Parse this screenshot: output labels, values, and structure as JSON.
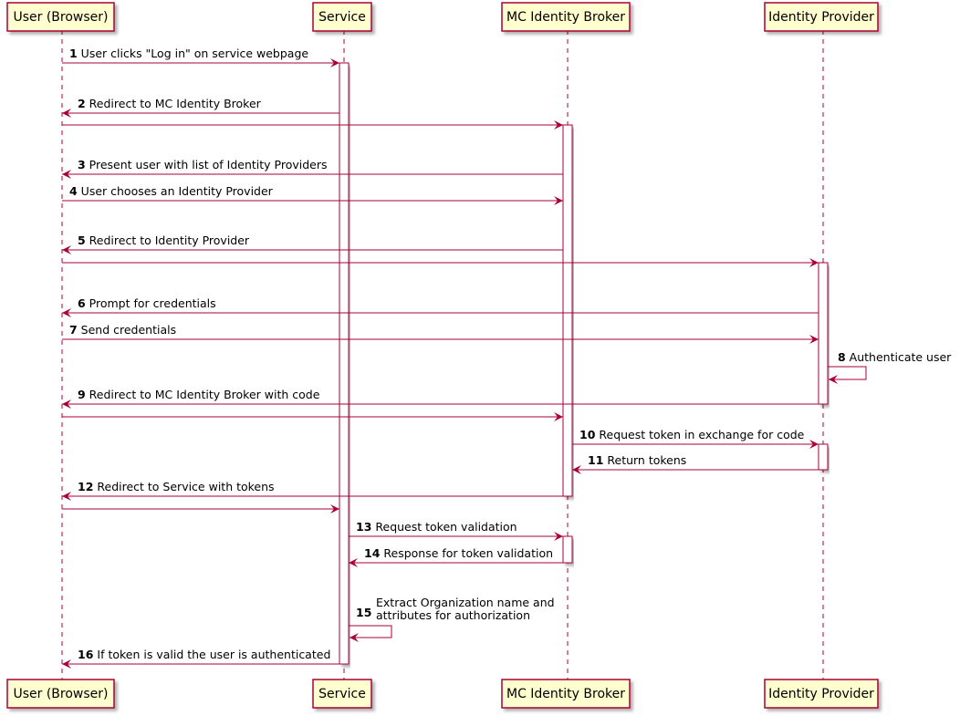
{
  "diagram": {
    "type": "sequence",
    "colors": {
      "participant_fill": "#FEFECE",
      "participant_border": "#A80036",
      "arrow": "#A80036",
      "activation_fill": "#FFFFFF",
      "shadow": "#B0B0B0"
    },
    "participants": [
      {
        "id": "user",
        "label": "User (Browser)"
      },
      {
        "id": "service",
        "label": "Service"
      },
      {
        "id": "broker",
        "label": "MC Identity Broker"
      },
      {
        "id": "idp",
        "label": "Identity Provider"
      }
    ],
    "messages": [
      {
        "num": "1",
        "text": "User clicks \"Log in\" on service webpage",
        "from": "user",
        "to": "service"
      },
      {
        "num": "2",
        "text": "Redirect to MC Identity Broker",
        "from": "service",
        "to": "user"
      },
      {
        "num": "",
        "text": "",
        "from": "user",
        "to": "broker"
      },
      {
        "num": "3",
        "text": "Present user with list of Identity Providers",
        "from": "broker",
        "to": "user"
      },
      {
        "num": "4",
        "text": "User chooses an Identity Provider",
        "from": "user",
        "to": "broker"
      },
      {
        "num": "5",
        "text": "Redirect to Identity Provider",
        "from": "broker",
        "to": "user"
      },
      {
        "num": "",
        "text": "",
        "from": "user",
        "to": "idp"
      },
      {
        "num": "6",
        "text": "Prompt for credentials",
        "from": "idp",
        "to": "user"
      },
      {
        "num": "7",
        "text": "Send credentials",
        "from": "user",
        "to": "idp"
      },
      {
        "num": "8",
        "text": "Authenticate user",
        "from": "idp",
        "to": "idp"
      },
      {
        "num": "9",
        "text": "Redirect to MC Identity Broker with code",
        "from": "idp",
        "to": "user"
      },
      {
        "num": "",
        "text": "",
        "from": "user",
        "to": "broker"
      },
      {
        "num": "10",
        "text": "Request token in exchange for code",
        "from": "broker",
        "to": "idp"
      },
      {
        "num": "11",
        "text": "Return tokens",
        "from": "idp",
        "to": "broker"
      },
      {
        "num": "12",
        "text": "Redirect to Service with tokens",
        "from": "broker",
        "to": "user"
      },
      {
        "num": "",
        "text": "",
        "from": "user",
        "to": "service"
      },
      {
        "num": "13",
        "text": "Request token validation",
        "from": "service",
        "to": "broker"
      },
      {
        "num": "14",
        "text": "Response for token validation",
        "from": "broker",
        "to": "service"
      },
      {
        "num": "15",
        "text": "Extract Organization name and\nattributes for authorization",
        "from": "service",
        "to": "service"
      },
      {
        "num": "16",
        "text": "If token is valid the user is authenticated",
        "from": "service",
        "to": "user"
      }
    ],
    "activations": [
      {
        "participant": "service",
        "from_msg": 0,
        "to_msg": 19
      },
      {
        "participant": "broker",
        "from_msg": 2,
        "to_msg": 14
      },
      {
        "participant": "idp",
        "from_msg": 6,
        "to_msg": 10
      },
      {
        "participant": "idp",
        "from_msg": 12,
        "to_msg": 13
      },
      {
        "participant": "broker",
        "from_msg": 16,
        "to_msg": 17
      }
    ]
  }
}
